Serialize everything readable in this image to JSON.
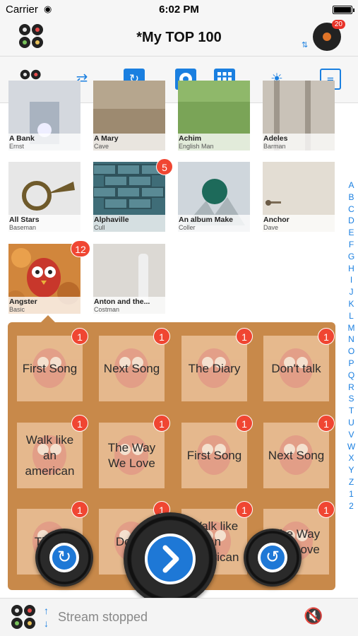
{
  "status": {
    "carrier": "Carrier",
    "time": "6:02 PM"
  },
  "nav": {
    "title": "*My TOP 100",
    "disc_badge": "20"
  },
  "toolbar": {
    "icons": [
      "reels-icon",
      "shuffle-icon",
      "repeat-icon",
      "record-icon",
      "grid-icon",
      "brightness-icon",
      "settings-icon"
    ]
  },
  "albums": [
    {
      "title": "A Bank",
      "artist": "Ernst"
    },
    {
      "title": "A Mary",
      "artist": "Cave"
    },
    {
      "title": "Achim",
      "artist": "English Man"
    },
    {
      "title": "Adeles",
      "artist": "Barman"
    },
    {
      "title": "All Stars",
      "artist": "Baseman"
    },
    {
      "title": "Alphaville",
      "artist": "Cull",
      "badge": "5"
    },
    {
      "title": "An album Make",
      "artist": "Coller"
    },
    {
      "title": "Anchor",
      "artist": "Dave"
    },
    {
      "title": "Angster",
      "artist": "Basic",
      "badge": "12"
    },
    {
      "title": "Anton and the...",
      "artist": "Costman"
    }
  ],
  "index_letters": [
    "A",
    "B",
    "C",
    "D",
    "E",
    "F",
    "G",
    "H",
    "I",
    "J",
    "K",
    "L",
    "M",
    "N",
    "O",
    "P",
    "Q",
    "R",
    "S",
    "T",
    "U",
    "V",
    "W",
    "X",
    "Y",
    "Z",
    "1",
    "2"
  ],
  "songs": [
    {
      "title": "First Song",
      "badge": "1"
    },
    {
      "title": "Next Song",
      "badge": "1"
    },
    {
      "title": "The Diary",
      "badge": "1"
    },
    {
      "title": "Don't talk",
      "badge": "1"
    },
    {
      "title": "Walk like an american",
      "badge": "1"
    },
    {
      "title": "The Way We Love",
      "badge": "1"
    },
    {
      "title": "First Song",
      "badge": "1"
    },
    {
      "title": "Next Song",
      "badge": "1"
    },
    {
      "title": "The...",
      "badge": "1"
    },
    {
      "title": "Don...",
      "badge": "1"
    },
    {
      "title": "Walk like an american",
      "badge": "1"
    },
    {
      "title": "The Way We Love",
      "badge": "1"
    }
  ],
  "bottom": {
    "stream_status": "Stream stopped"
  },
  "colors": {
    "accent": "#1a7fe0",
    "badge": "#f04632",
    "panel": "#c8894a"
  }
}
